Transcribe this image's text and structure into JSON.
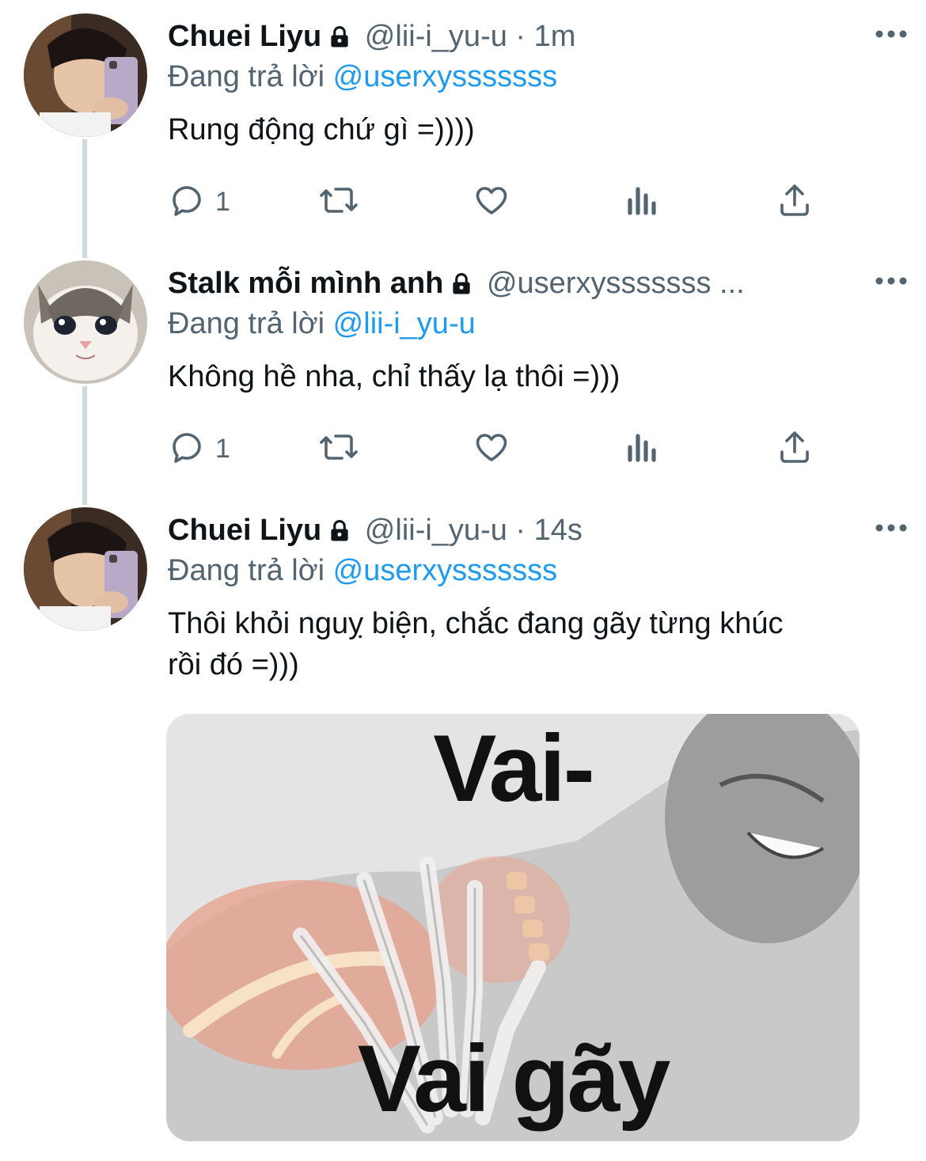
{
  "tweets": [
    {
      "name": "Chuei Liyu",
      "handle": "@lii-i_yu-u",
      "separator": "·",
      "time": "1m",
      "reply_prefix": "Đang trả lời",
      "reply_to": "@userxysssssss",
      "text": "Rung động chứ gì =))))",
      "reply_count": "1",
      "avatar_icon": "person-selfie-avatar"
    },
    {
      "name": "Stalk mỗi mình anh",
      "handle": "@userxysssssss ...",
      "reply_prefix": "Đang trả lời",
      "reply_to": "@lii-i_yu-u",
      "text": "Không hề nha, chỉ thấy lạ thôi =)))",
      "reply_count": "1",
      "avatar_icon": "crying-cat-avatar"
    },
    {
      "name": "Chuei Liyu",
      "handle": "@lii-i_yu-u",
      "separator": "·",
      "time": "14s",
      "reply_prefix": "Đang trả lời",
      "reply_to": "@userxysssssss",
      "text": "Thôi khỏi nguỵ biện, chắc đang gãy từng khúc\nrồi đó =)))",
      "avatar_icon": "person-selfie-avatar",
      "media": {
        "caption_top": "Vai-",
        "caption_bottom": "Vai gãy"
      }
    }
  ],
  "colors": {
    "link": "#1d9bf0",
    "secondary_text": "#536471",
    "primary_text": "#0f1419",
    "thread_line": "#cfd9de"
  },
  "icons": [
    "lock-icon",
    "more-icon",
    "reply-icon",
    "retweet-icon",
    "like-icon",
    "views-icon",
    "share-icon"
  ]
}
